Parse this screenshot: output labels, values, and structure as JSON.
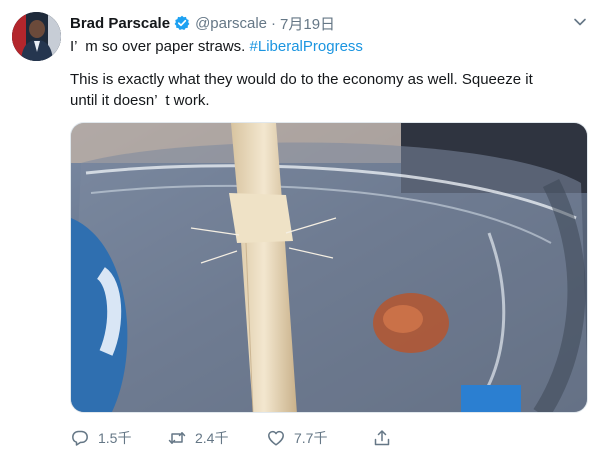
{
  "tweet": {
    "author_name": "Brad Parscale",
    "handle": "@parscale",
    "separator": "·",
    "date": "7月19日",
    "line1_text": "I’  m so over paper straws. ",
    "line1_hashtag": "#LiberalProgress",
    "line2": "This is exactly what they would do to the economy as well. Squeeze it",
    "line3": "until it doesn’  t work."
  },
  "actions": {
    "reply_count": "1.5千",
    "retweet_count": "2.4千",
    "like_count": "7.7千"
  },
  "colors": {
    "link": "#1b95e0",
    "muted": "#657786",
    "text": "#14171a",
    "verified": "#1da1f2"
  },
  "icons": [
    "verified-badge-icon",
    "chevron-down-icon",
    "reply-icon",
    "retweet-icon",
    "like-icon",
    "share-icon"
  ]
}
